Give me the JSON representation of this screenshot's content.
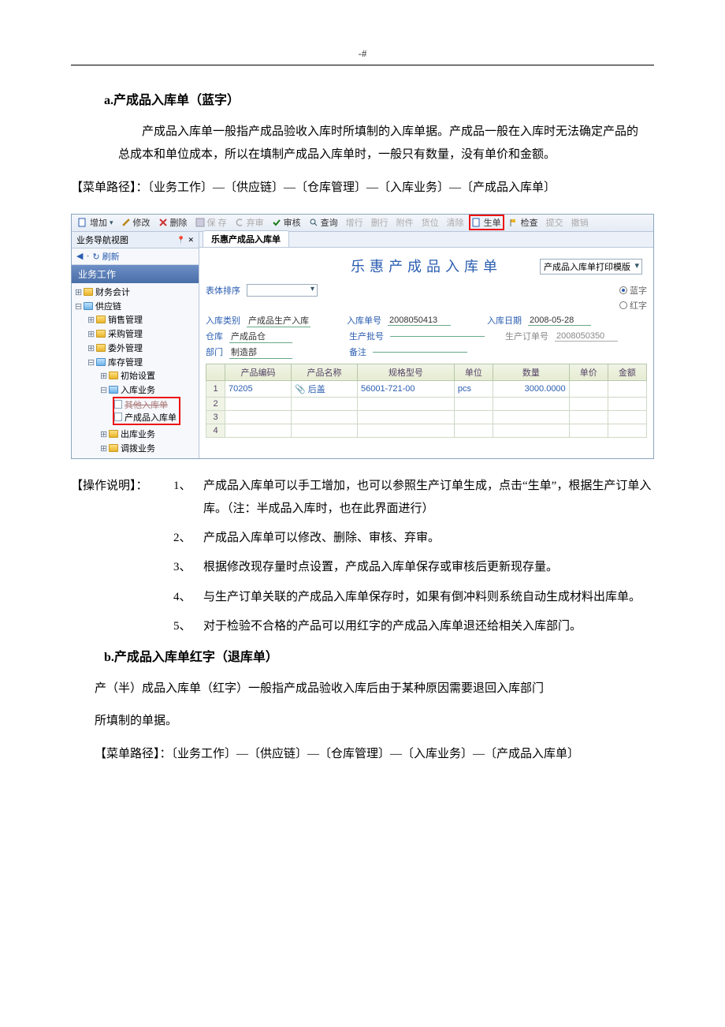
{
  "page_header": "-#",
  "section_a": {
    "title": "a.产成品入库单（蓝字）",
    "paragraph": "产成品入库单一般指产成品验收入库时所填制的入库单据。产成品一般在入库时无法确定产品的总成本和单位成本，所以在填制产成品入库单时，一般只有数量，没有单价和金额。",
    "menu_path": "【菜单路径】：〔业务工作〕—〔供应链〕—〔仓库管理〕—〔入库业务〕—〔产成品入库单〕"
  },
  "screenshot": {
    "toolbar": {
      "add": "增加",
      "modify": "修改",
      "delete": "删除",
      "save": "保 存",
      "drop": "弃审",
      "audit": "审核",
      "query": "查询",
      "addrow": "增行",
      "delrow": "删行",
      "attach": "附件",
      "locate": "货位",
      "clear": "清除",
      "gen": "生单",
      "inspect": "检查",
      "submit": "提交",
      "revoke": "撤销"
    },
    "nav_title": "业务导航视图",
    "nav_close": "✕",
    "nav_pin": "📌",
    "nav_back": "◀",
    "nav_refresh": "刷新",
    "biz_title": "业务工作",
    "tree": {
      "fin": "财务会计",
      "scm": "供应链",
      "sales": "销售管理",
      "purchase": "采购管理",
      "outsource": "委外管理",
      "inventory": "库存管理",
      "init": "初始设置",
      "inbound": "入库业务",
      "other_inbound": "其他入库单",
      "product_inbound": "产成品入库单",
      "outbound": "出库业务",
      "transfer": "调拨业务"
    },
    "tab": "乐惠产成品入库单",
    "title": "乐惠产成品入库单",
    "tpl_select": "产成品入库单打印模版",
    "sort_label": "表体排序",
    "radio_blue": "蓝字",
    "radio_red": "红字",
    "fields": {
      "in_type_lbl": "入库类别",
      "in_type_val": "产成品生产入库",
      "in_no_lbl": "入库单号",
      "in_no_val": "2008050413",
      "in_date_lbl": "入库日期",
      "in_date_val": "2008-05-28",
      "wh_lbl": "仓库",
      "wh_val": "产成品仓",
      "batch_lbl": "生产批号",
      "batch_val": "",
      "order_lbl": "生产订单号",
      "order_val": "2008050350",
      "dept_lbl": "部门",
      "dept_val": "制造部",
      "remark_lbl": "备注",
      "remark_val": ""
    },
    "grid": {
      "headers": [
        "",
        "产品编码",
        "产品名称",
        "规格型号",
        "单位",
        "数量",
        "单价",
        "金额"
      ],
      "rows": [
        {
          "n": "1",
          "code": "70205",
          "name": "后盖",
          "spec": "56001-721-00",
          "unit": "pcs",
          "qty": "3000.0000",
          "price": "",
          "amount": ""
        },
        {
          "n": "2",
          "code": "",
          "name": "",
          "spec": "",
          "unit": "",
          "qty": "",
          "price": "",
          "amount": ""
        },
        {
          "n": "3",
          "code": "",
          "name": "",
          "spec": "",
          "unit": "",
          "qty": "",
          "price": "",
          "amount": ""
        },
        {
          "n": "4",
          "code": "",
          "name": "",
          "spec": "",
          "unit": "",
          "qty": "",
          "price": "",
          "amount": ""
        }
      ]
    }
  },
  "instructions": {
    "label": "【操作说明】：",
    "items": [
      "产成品入库单可以手工增加，也可以参照生产订单生成，点击“生单”，根据生产订单入库。（注：半成品入库时，也在此界面进行）",
      "产成品入库单可以修改、删除、审核、弃审。",
      "根据修改现存量时点设置，产成品入库单保存或审核后更新现存量。",
      "与生产订单关联的产成品入库单保存时，如果有倒冲料则系统自动生成材料出库单。",
      "对于检验不合格的产品可以用红字的产成品入库单退还给相关入库部门。"
    ],
    "nums": [
      "1、",
      "2、",
      "3、",
      "4、",
      "5、"
    ]
  },
  "section_b": {
    "title": "b.产成品入库单红字（退库单）",
    "para1": "产（半）成品入库单（红字）一般指产成品验收入库后由于某种原因需要退回入库部门",
    "para2": "所填制的单据。",
    "menu_path": "【菜单路径】：〔业务工作〕—〔供应链〕—〔仓库管理〕—〔入库业务〕—〔产成品入库单〕"
  }
}
